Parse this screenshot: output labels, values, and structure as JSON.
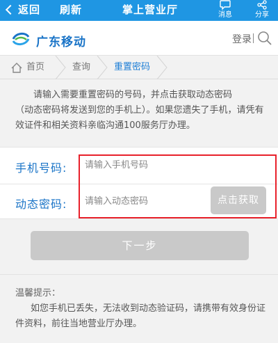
{
  "appbar": {
    "back_label": "返回",
    "refresh_label": "刷新",
    "title": "掌上营业厅",
    "message_label": "消息",
    "message_icon": "message-icon",
    "share_label": "分享",
    "share_icon": "share-icon",
    "color": "#1f96e3"
  },
  "brand": {
    "name": "广东移动",
    "login_label": "登录",
    "logo_icon": "china-mobile-logo",
    "search_icon": "search-icon",
    "color": "#1a74c7"
  },
  "breadcrumb": {
    "items": [
      "首页",
      "查询",
      "重置密码"
    ],
    "home_icon": "home-icon"
  },
  "description": {
    "line1": "请输入需要重置密码的号码，并点击获取动态密码",
    "line2": "（动态密码将发送到您的手机上）。如果您遗失了手机，请凭有效证件和相关资料亲临沟通100服务厅办理。"
  },
  "form": {
    "phone_label": "手机号码:",
    "phone_placeholder": "请输入手机号码",
    "phone_value": "",
    "code_label": "动态密码:",
    "code_placeholder": "请输入动态密码",
    "code_value": "",
    "get_code_label": "点击获取",
    "highlight_color": "#e8202a"
  },
  "next_label": "下一步",
  "tips": {
    "title": "温馨提示：",
    "body": "如您手机已丢失，无法收到动态验证码，请携带有效身份证件资料，前往当地营业厅办理。"
  }
}
